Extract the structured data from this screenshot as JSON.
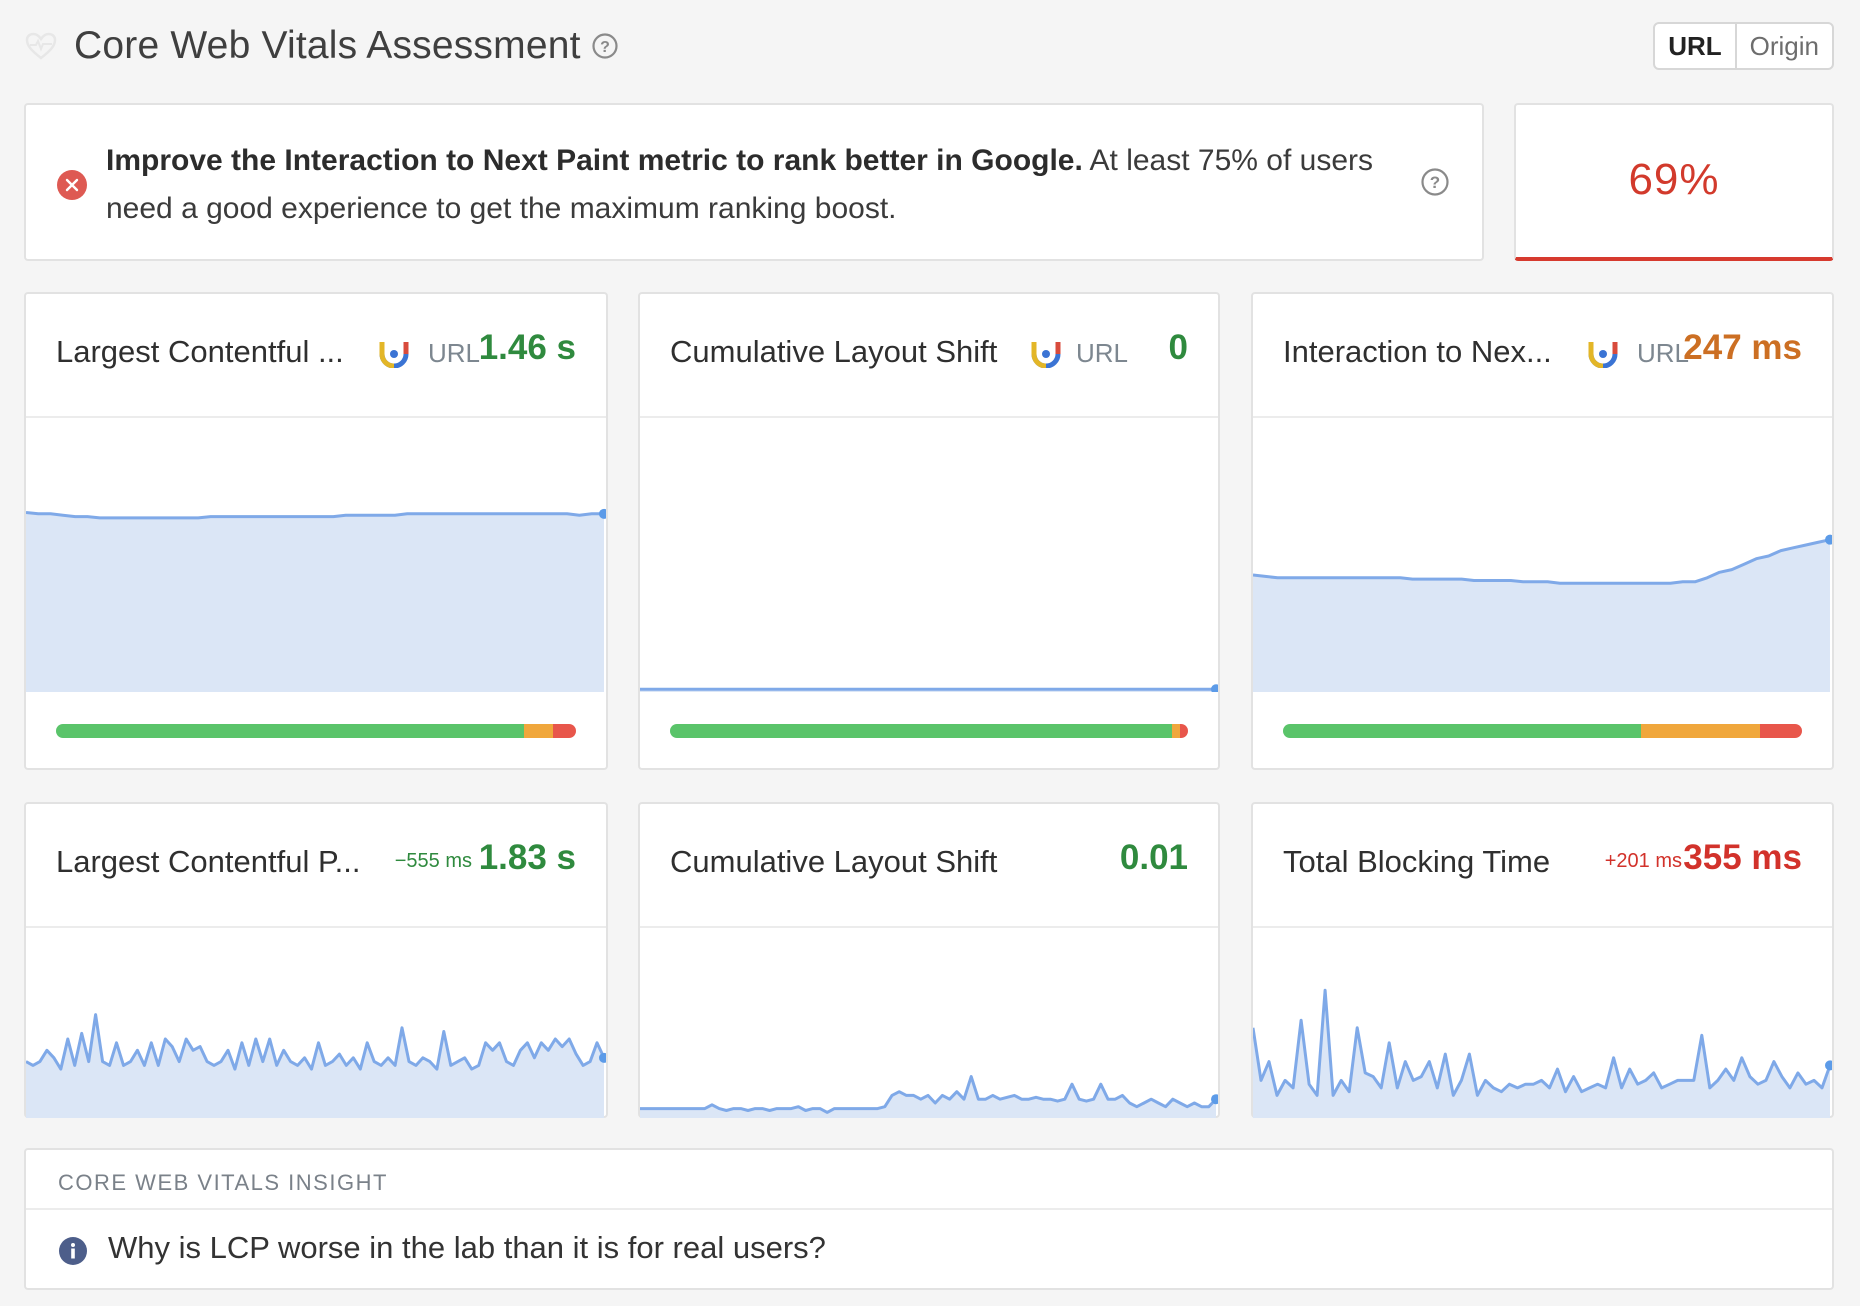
{
  "header": {
    "title": "Core Web Vitals Assessment",
    "scope_options": [
      "URL",
      "Origin"
    ],
    "scope_selected": "URL"
  },
  "assessment": {
    "bold_text": "Improve the Interaction to Next Paint metric to rank better in Google.",
    "rest_text": " At least 75% of users need a good experience to get the maximum ranking boost.",
    "score": "69%",
    "status_color": "#d63a2e"
  },
  "field_metrics": [
    {
      "name": "Largest Contentful Paint",
      "display_name": "Largest Contentful ...",
      "source": "URL",
      "value": "1.46 s",
      "status": "good",
      "distribution": {
        "good": 0.9,
        "needs_improvement": 0.055,
        "poor": 0.045
      },
      "trend": [
        0.66,
        0.655,
        0.655,
        0.65,
        0.645,
        0.645,
        0.64,
        0.64,
        0.64,
        0.64,
        0.64,
        0.64,
        0.64,
        0.64,
        0.64,
        0.645,
        0.645,
        0.645,
        0.645,
        0.645,
        0.645,
        0.645,
        0.645,
        0.645,
        0.645,
        0.645,
        0.65,
        0.65,
        0.65,
        0.65,
        0.65,
        0.655,
        0.655,
        0.655,
        0.655,
        0.655,
        0.655,
        0.655,
        0.655,
        0.655,
        0.655,
        0.655,
        0.655,
        0.655,
        0.655,
        0.65,
        0.655,
        0.655
      ]
    },
    {
      "name": "Cumulative Layout Shift",
      "display_name": "Cumulative Layout Shift",
      "source": "URL",
      "value": "0",
      "status": "good",
      "distribution": {
        "good": 0.97,
        "needs_improvement": 0.015,
        "poor": 0.015
      },
      "trend": [
        0.01,
        0.01,
        0.01,
        0.01,
        0.01,
        0.01,
        0.01,
        0.01,
        0.01,
        0.01,
        0.01,
        0.01,
        0.01,
        0.01,
        0.01,
        0.01,
        0.01,
        0.01,
        0.01,
        0.01
      ]
    },
    {
      "name": "Interaction to Next Paint",
      "display_name": "Interaction to Nex...",
      "source": "URL",
      "value": "247 ms",
      "status": "needs-improvement",
      "distribution": {
        "good": 0.69,
        "needs_improvement": 0.23,
        "poor": 0.08
      },
      "trend": [
        0.43,
        0.425,
        0.42,
        0.42,
        0.42,
        0.42,
        0.42,
        0.42,
        0.42,
        0.42,
        0.42,
        0.42,
        0.42,
        0.415,
        0.415,
        0.415,
        0.415,
        0.415,
        0.41,
        0.41,
        0.41,
        0.41,
        0.405,
        0.405,
        0.405,
        0.4,
        0.4,
        0.4,
        0.4,
        0.4,
        0.4,
        0.4,
        0.4,
        0.4,
        0.4,
        0.405,
        0.405,
        0.42,
        0.44,
        0.45,
        0.47,
        0.49,
        0.5,
        0.52,
        0.53,
        0.54,
        0.55,
        0.56
      ]
    }
  ],
  "lab_metrics": [
    {
      "name": "Largest Contentful Paint",
      "display_name": "Largest Contentful P...",
      "delta": "−555 ms",
      "delta_status": "good",
      "value": "1.83 s",
      "status": "good",
      "trend": [
        0.3,
        0.28,
        0.3,
        0.36,
        0.32,
        0.26,
        0.42,
        0.28,
        0.45,
        0.3,
        0.55,
        0.3,
        0.28,
        0.4,
        0.28,
        0.3,
        0.36,
        0.28,
        0.4,
        0.28,
        0.42,
        0.38,
        0.3,
        0.42,
        0.36,
        0.38,
        0.3,
        0.28,
        0.3,
        0.36,
        0.26,
        0.4,
        0.28,
        0.42,
        0.3,
        0.42,
        0.28,
        0.36,
        0.3,
        0.28,
        0.32,
        0.26,
        0.4,
        0.28,
        0.3,
        0.34,
        0.28,
        0.32,
        0.26,
        0.4,
        0.3,
        0.28,
        0.32,
        0.28,
        0.48,
        0.3,
        0.28,
        0.32,
        0.3,
        0.26,
        0.46,
        0.28,
        0.3,
        0.32,
        0.26,
        0.28,
        0.4,
        0.36,
        0.4,
        0.3,
        0.28,
        0.36,
        0.4,
        0.32,
        0.4,
        0.36,
        0.42,
        0.38,
        0.42,
        0.34,
        0.28,
        0.3,
        0.4,
        0.32
      ]
    },
    {
      "name": "Cumulative Layout Shift",
      "display_name": "Cumulative Layout Shift",
      "value": "0.01",
      "status": "good",
      "trend": [
        0.05,
        0.05,
        0.05,
        0.05,
        0.05,
        0.05,
        0.05,
        0.05,
        0.05,
        0.05,
        0.07,
        0.05,
        0.04,
        0.05,
        0.05,
        0.04,
        0.05,
        0.05,
        0.04,
        0.05,
        0.05,
        0.05,
        0.06,
        0.04,
        0.05,
        0.05,
        0.03,
        0.05,
        0.05,
        0.05,
        0.05,
        0.05,
        0.05,
        0.05,
        0.06,
        0.12,
        0.14,
        0.12,
        0.12,
        0.1,
        0.12,
        0.08,
        0.12,
        0.1,
        0.14,
        0.1,
        0.22,
        0.1,
        0.1,
        0.12,
        0.1,
        0.11,
        0.12,
        0.1,
        0.1,
        0.11,
        0.1,
        0.1,
        0.09,
        0.1,
        0.18,
        0.1,
        0.09,
        0.1,
        0.18,
        0.1,
        0.1,
        0.12,
        0.08,
        0.06,
        0.08,
        0.1,
        0.08,
        0.06,
        0.1,
        0.08,
        0.06,
        0.08,
        0.06,
        0.06,
        0.1
      ]
    },
    {
      "name": "Total Blocking Time",
      "display_name": "Total Blocking Time",
      "delta": "+201 ms",
      "delta_status": "poor",
      "value": "355 ms",
      "status": "poor",
      "trend": [
        0.48,
        0.2,
        0.3,
        0.12,
        0.2,
        0.16,
        0.52,
        0.18,
        0.12,
        0.68,
        0.12,
        0.2,
        0.14,
        0.48,
        0.24,
        0.22,
        0.16,
        0.4,
        0.16,
        0.3,
        0.2,
        0.22,
        0.3,
        0.16,
        0.34,
        0.12,
        0.2,
        0.34,
        0.12,
        0.2,
        0.16,
        0.14,
        0.18,
        0.16,
        0.18,
        0.18,
        0.2,
        0.16,
        0.26,
        0.14,
        0.22,
        0.14,
        0.16,
        0.18,
        0.16,
        0.32,
        0.16,
        0.26,
        0.18,
        0.2,
        0.24,
        0.16,
        0.18,
        0.2,
        0.2,
        0.2,
        0.44,
        0.16,
        0.2,
        0.26,
        0.2,
        0.32,
        0.22,
        0.18,
        0.2,
        0.3,
        0.22,
        0.16,
        0.24,
        0.18,
        0.2,
        0.16,
        0.28
      ]
    }
  ],
  "insight": {
    "label": "CORE WEB VITALS INSIGHT",
    "question": "Why is LCP worse in the lab than it is for real users?"
  },
  "colors": {
    "good": "#5ac46a",
    "needs_improvement": "#f0a73c",
    "poor": "#e8564b",
    "chart_line": "#7fa9e8",
    "chart_fill": "#dbe6f6"
  }
}
